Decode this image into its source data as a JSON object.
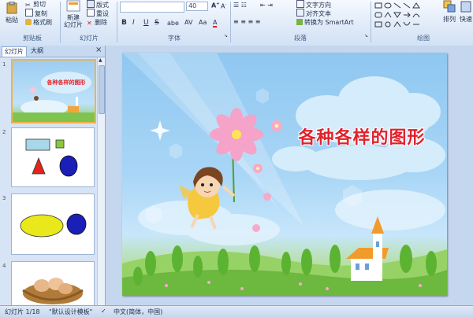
{
  "ribbon": {
    "clipboard": {
      "paste": "粘贴",
      "cut": "剪切",
      "copy": "复制",
      "format_painter": "格式刷",
      "label": "剪贴板"
    },
    "slides": {
      "new_slide": "新建\n幻灯片",
      "layout": "版式",
      "reset": "重设",
      "delete": "删除",
      "label": "幻灯片"
    },
    "font": {
      "font_name": "",
      "font_size": "40",
      "bold": "B",
      "italic": "I",
      "underline": "U",
      "strike": "S",
      "shadow": "abe",
      "label": "字体"
    },
    "paragraph": {
      "text_direction": "文字方向",
      "align_text": "对齐文本",
      "smartart": "转换为 SmartArt",
      "label": "段落"
    },
    "drawing": {
      "arrange": "排列",
      "quick_styles": "快速",
      "label": "绘图"
    }
  },
  "panel": {
    "tab_slides": "幻灯片",
    "tab_outline": "大纲",
    "close": "×",
    "slide_numbers": [
      "1",
      "2",
      "3",
      "4"
    ]
  },
  "slide": {
    "title": "各种各样的图形"
  },
  "statusbar": {
    "slide_info": "幻灯片 1/18",
    "theme": "\"默认设计模板\"",
    "language": "中文(简体，中国)"
  },
  "colors": {
    "title_red": "#e0222b",
    "thumb_blue_square": "#a9d7ea",
    "thumb_green_square": "#8cc63f",
    "thumb_red_triangle": "#e1251b",
    "thumb_blue_circle": "#1a1fb8",
    "thumb_yellow_ellipse": "#e8e81a"
  }
}
